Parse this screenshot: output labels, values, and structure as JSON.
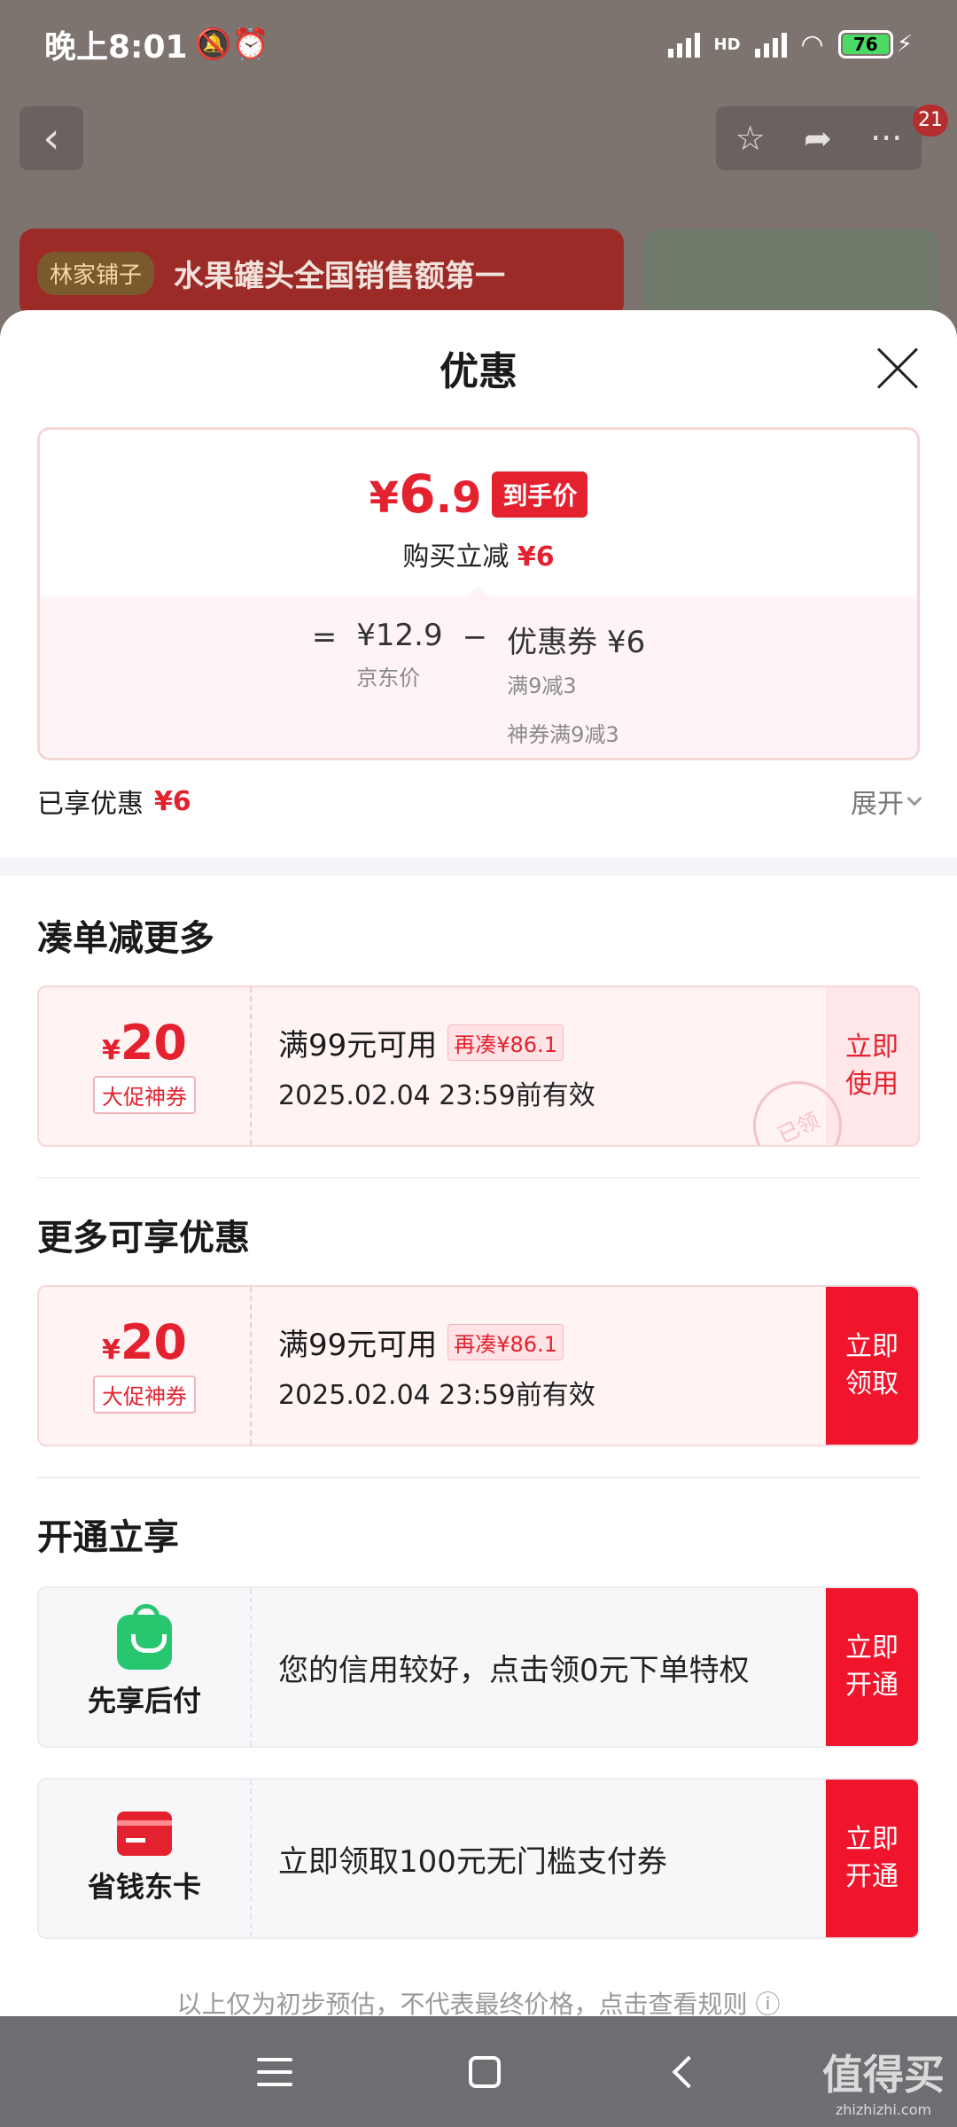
{
  "status_bar": {
    "time": "晚上8:01",
    "icons": "🔕⏰",
    "hd_label": "HD",
    "battery": "76"
  },
  "bg_page": {
    "badge_count": "21",
    "banner_logo": "林家铺子",
    "banner_text": "水果罐头全国销售额第一"
  },
  "sheet": {
    "title": "优惠"
  },
  "price": {
    "currency": "¥",
    "final_int": "6",
    "final_dec": ".9",
    "final_tag": "到手价",
    "reduce_label": "购买立减",
    "reduce_value": "¥6",
    "eq": "=",
    "minus": "−",
    "jd_price": "¥12.9",
    "jd_label": "京东价",
    "coupon_label": "优惠券 ¥6",
    "coupon_sub1": "满9减3",
    "coupon_sub2": "神券满9减3"
  },
  "enjoyed": {
    "label": "已享优惠",
    "value": "¥6",
    "expand": "展开"
  },
  "sections": {
    "more_items": "凑单减更多",
    "more_offers": "更多可享优惠",
    "open_enjoy": "开通立享"
  },
  "coupons": [
    {
      "yen": "¥",
      "amount": "20",
      "tag": "大促神券",
      "condition": "满99元可用",
      "chip": "再凑¥86.1",
      "expiry": "2025.02.04 23:59前有效",
      "button": "立即\n使用",
      "stamp": "已领"
    },
    {
      "yen": "¥",
      "amount": "20",
      "tag": "大促神券",
      "condition": "满99元可用",
      "chip": "再凑¥86.1",
      "expiry": "2025.02.04 23:59前有效",
      "button": "立即\n领取"
    }
  ],
  "services": [
    {
      "icon": "shopping-bag-icon",
      "name": "先享后付",
      "desc": "您的信用较好，点击领0元下单特权",
      "button": "立即\n开通"
    },
    {
      "icon": "card-icon",
      "name": "省钱东卡",
      "desc": "立即领取100元无门槛支付券",
      "button": "立即\n开通"
    }
  ],
  "disclaimer": "以上仅为初步预估，不代表最终价格，点击查看规则 ⓘ",
  "watermark": {
    "big": "值得买",
    "small": "zhizhizhi.com"
  },
  "colors": {
    "brand_red": "#e4222f",
    "button_red": "#f0142c",
    "sheet_bg": "#ffffff",
    "dim_bg": "#7d7470"
  }
}
